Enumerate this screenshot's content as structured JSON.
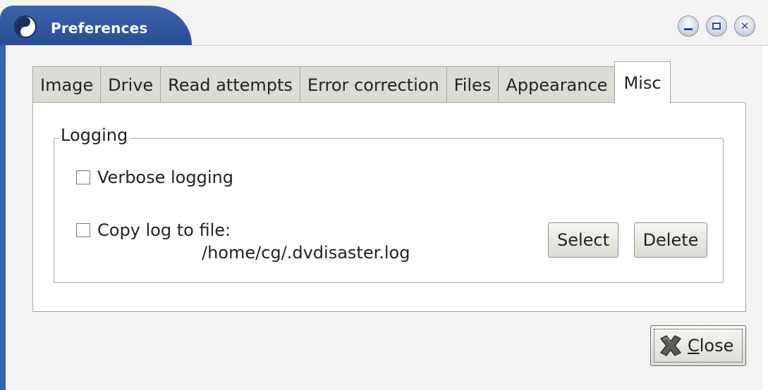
{
  "window": {
    "title": "Preferences"
  },
  "tabs": [
    {
      "label": "Image"
    },
    {
      "label": "Drive"
    },
    {
      "label": "Read attempts"
    },
    {
      "label": "Error correction"
    },
    {
      "label": "Files"
    },
    {
      "label": "Appearance"
    },
    {
      "label": "Misc"
    }
  ],
  "active_tab": "Misc",
  "logging": {
    "frame_label": "Logging",
    "verbose_label": "Verbose logging",
    "verbose_checked": false,
    "copy_label": "Copy log to file:",
    "copy_checked": false,
    "log_path": "/home/cg/.dvdisaster.log",
    "select_label": "Select",
    "delete_label": "Delete"
  },
  "footer": {
    "close_mnemonic": "C",
    "close_rest": "lose"
  },
  "colors": {
    "title_blue": "#3c63ad",
    "tab_inactive": "#dcdcd6",
    "dialog_bg": "#f3f3f3"
  }
}
